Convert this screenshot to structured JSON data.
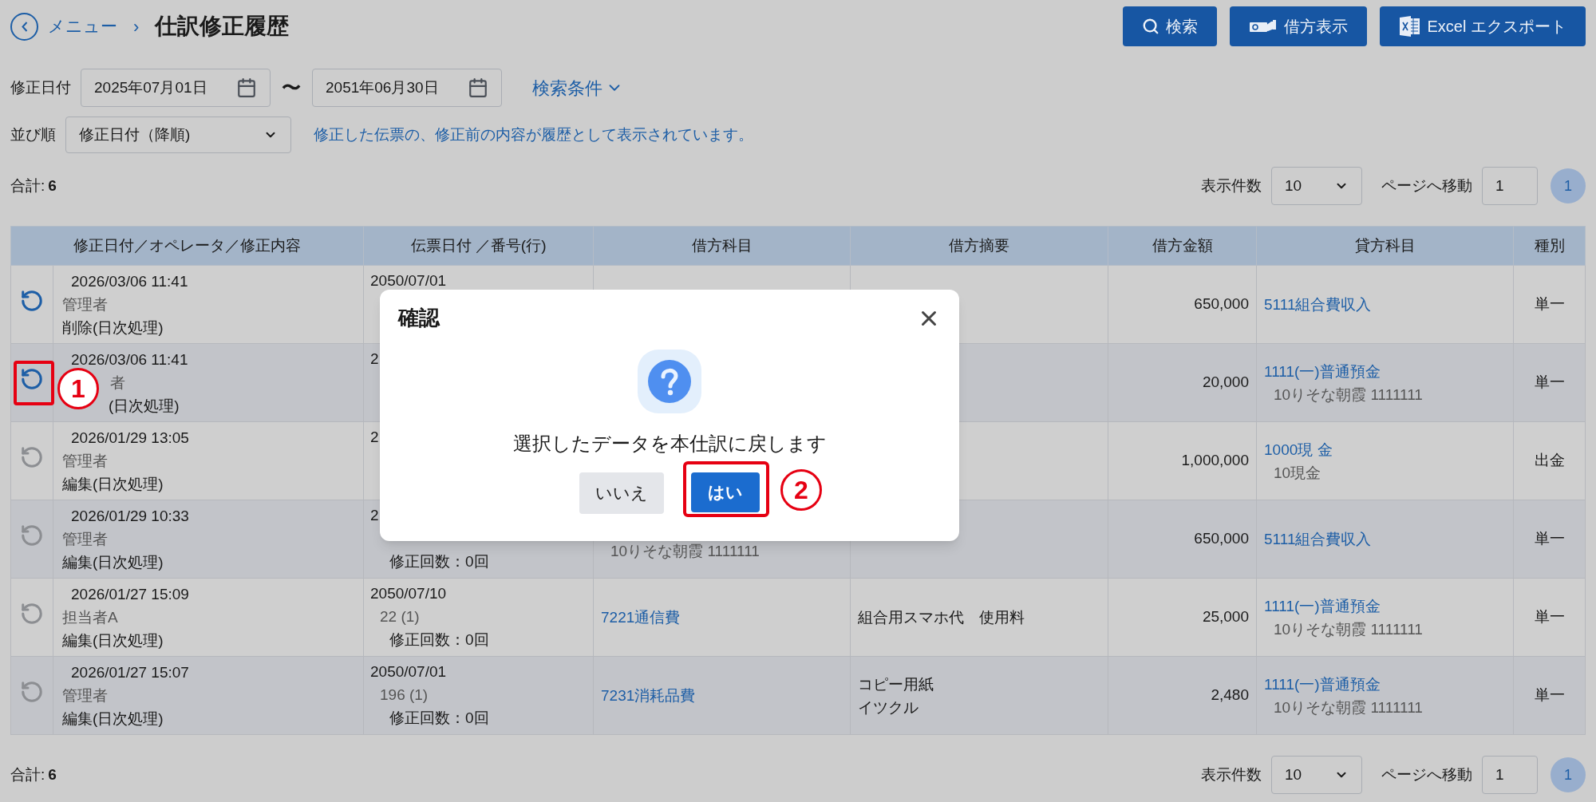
{
  "breadcrumb": {
    "menu": "メニュー",
    "separator": "›",
    "title": "仕訳修正履歴"
  },
  "toolbar": [
    {
      "kind": "search",
      "label": "検索"
    },
    {
      "kind": "debit",
      "label": "借方表示"
    },
    {
      "kind": "excel",
      "label": "Excel エクスポート"
    }
  ],
  "filters": {
    "date_label": "修正日付",
    "date_from": "2025年07月01日",
    "range_sep": "〜",
    "date_to": "2051年06月30日",
    "conditions": "検索条件",
    "sort_label": "並び順",
    "sort_value": "修正日付（降順)",
    "notice": "修正した伝票の、修正前の内容が履歴として表示されています。"
  },
  "summary_top": {
    "total_label": "合計:",
    "total": "6",
    "per_page_label": "表示件数",
    "per_page": "10",
    "goto_label": "ページへ移動",
    "goto": "1",
    "pages": [
      {
        "label": "1",
        "selected": true
      }
    ]
  },
  "table": {
    "columns": [
      "修正日付／オペレータ／修正内容",
      "伝票日付 ／番号(行)",
      "借方科目",
      "借方摘要",
      "借方金額",
      "貸方科目",
      "種別"
    ],
    "rows": [
      {
        "restorable": true,
        "modified_at": "2026/03/06 11:41",
        "operator": "管理者",
        "change": "削除(日次処理)",
        "slip_date": "2050/07/01",
        "amount": "650,000",
        "credit_account": "5111組合費収入",
        "type": "単一"
      },
      {
        "restorable": true,
        "step_marker": "1",
        "modified_at": "2026/03/06 11:41",
        "operator": "者",
        "change": "(日次処理)",
        "slip_date": "2",
        "amount": "20,000",
        "credit_account": "1111(一)普通預金",
        "credit_sub": "10りそな朝霞 1111111",
        "type": "単一"
      },
      {
        "restorable": false,
        "modified_at": "2026/01/29 13:05",
        "operator": "管理者",
        "change": "編集(日次処理)",
        "slip_date": "2",
        "amount": "1,000,000",
        "credit_account": "1000現 金",
        "credit_sub": "10現金",
        "type": "出金"
      },
      {
        "restorable": false,
        "modified_at": "2026/01/29 10:33",
        "operator": "管理者",
        "change": "編集(日次処理)",
        "slip_date": "2",
        "edits": "修正回数：0回",
        "debit_sub": "10りそな朝霞 1111111",
        "amount": "650,000",
        "credit_account": "5111組合費収入",
        "type": "単一"
      },
      {
        "restorable": false,
        "modified_at": "2026/01/27 15:09",
        "operator": "担当者A",
        "change": "編集(日次処理)",
        "slip_date": "2050/07/10",
        "slip_no": "22 (1)",
        "edits": "修正回数：0回",
        "debit_account": "7221通信費",
        "debit_memo": [
          "組合用スマホ代　使用料"
        ],
        "amount": "25,000",
        "credit_account": "1111(一)普通預金",
        "credit_sub": "10りそな朝霞 1111111",
        "type": "単一"
      },
      {
        "restorable": false,
        "modified_at": "2026/01/27 15:07",
        "operator": "管理者",
        "change": "編集(日次処理)",
        "slip_date": "2050/07/01",
        "slip_no": "196 (1)",
        "edits": "修正回数：0回",
        "debit_account": "7231消耗品費",
        "debit_memo": [
          "コピー用紙",
          "イツクル"
        ],
        "amount": "2,480",
        "credit_account": "1111(一)普通預金",
        "credit_sub": "10りそな朝霞 1111111",
        "type": "単一"
      }
    ]
  },
  "summary_bottom": {
    "total_label": "合計:",
    "total": "6",
    "per_page_label": "表示件数",
    "per_page": "10",
    "goto_label": "ページへ移動",
    "goto": "1",
    "pages": [
      {
        "label": "1",
        "selected": true
      }
    ]
  },
  "dialog": {
    "title": "確認",
    "message": "選択したデータを本仕訳に戻します",
    "buttons": [
      {
        "kind": "secondary",
        "label": "いいえ"
      },
      {
        "kind": "primary",
        "label": "はい"
      }
    ]
  },
  "annotations": [
    {
      "label": "2"
    }
  ]
}
